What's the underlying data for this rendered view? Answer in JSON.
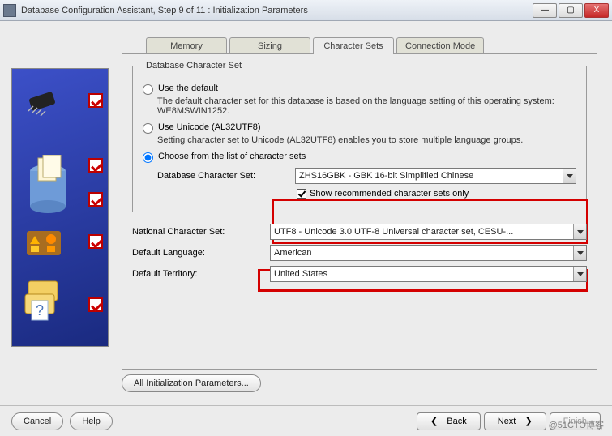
{
  "window": {
    "title": "Database Configuration Assistant, Step 9 of 11 : Initialization Parameters",
    "buttons": {
      "min": "—",
      "max": "▢",
      "close": "X"
    }
  },
  "tabs": {
    "items": [
      "Memory",
      "Sizing",
      "Character Sets",
      "Connection Mode"
    ],
    "active": 2
  },
  "group": {
    "legend": "Database Character Set",
    "opt1": {
      "label": "Use the default",
      "desc": "The default character set for this database is based on the language setting of this operating system: WE8MSWIN1252."
    },
    "opt2": {
      "label": "Use Unicode (AL32UTF8)",
      "desc": "Setting character set to Unicode (AL32UTF8) enables you to store multiple language groups."
    },
    "opt3": {
      "label": "Choose from the list of character sets"
    },
    "dbcs_label": "Database Character Set:",
    "dbcs_value": "ZHS16GBK - GBK 16-bit Simplified Chinese",
    "show_recommended": "Show recommended character sets only"
  },
  "fields": {
    "ncs_label": "National Character Set:",
    "ncs_value": "UTF8 - Unicode 3.0 UTF-8 Universal character set, CESU-...",
    "lang_label": "Default Language:",
    "lang_value": "American",
    "terr_label": "Default Territory:",
    "terr_value": "United States"
  },
  "all_params_btn": "All Initialization Parameters...",
  "footer": {
    "cancel": "Cancel",
    "help": "Help",
    "back": "Back",
    "next": "Next",
    "finish": "Finish"
  },
  "watermark": "@51CTO博客"
}
